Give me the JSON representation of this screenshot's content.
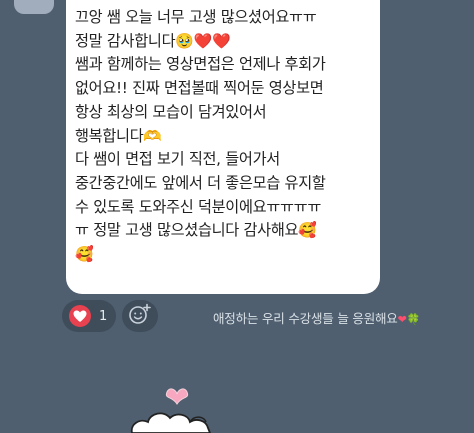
{
  "message": {
    "lines": [
      "끄앙 쌤 오늘 너무 고생 많으셨어요ㅠㅠ",
      "정말 감사합니다",
      "쌤과 함께하는 영상면접은 언제나 후회가",
      "없어요!! 진짜 면접볼때 찍어둔 영상보면",
      "항상 최상의 모습이 담겨있어서",
      "행복합니다",
      "다 쌤이 면접 보기 직전, 들어가서",
      "중간중간에도 앞에서 더 좋은모습 유지할",
      "수 있도록 도와주신 덕분이에요ㅠㅠㅠㅠ",
      "ㅠ 정말 고생 많으셨습니다 감사해요",
      ""
    ],
    "emojis": {
      "line2": "🥹❤️❤️",
      "line6": "🫶",
      "line10": "🥰",
      "line11": "🥰"
    }
  },
  "reactions": {
    "heart_count": "1",
    "heart_icon": "heart-icon",
    "add_icon": "add-reaction-icon"
  },
  "caption": {
    "text": "애정하는  우리  수강생들  늘  응원해요",
    "heart": "❤",
    "clover": "🍀"
  },
  "colors": {
    "background": "#4f5f6f",
    "bubble": "#ffffff",
    "heart": "#e8414f",
    "accent_pink": "#f7a8c0"
  }
}
